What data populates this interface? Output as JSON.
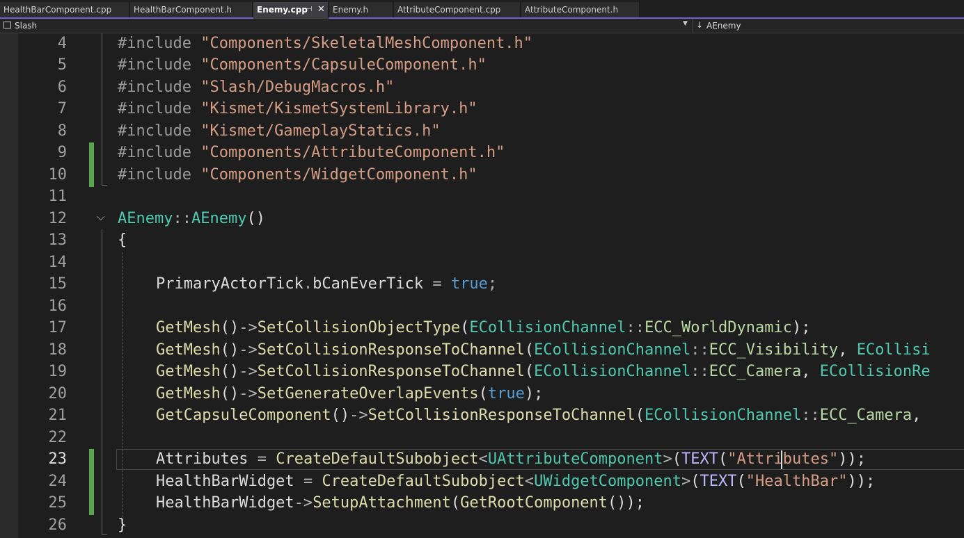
{
  "tabs": [
    {
      "label": "HealthBarComponent.cpp",
      "active": false
    },
    {
      "label": "HealthBarComponent.h",
      "active": false
    },
    {
      "label": "Enemy.cpp",
      "active": true
    },
    {
      "label": "Enemy.h",
      "active": false
    },
    {
      "label": "AttributeComponent.cpp",
      "active": false
    },
    {
      "label": "AttributeComponent.h",
      "active": false
    }
  ],
  "navbar": {
    "project": "Slash",
    "scope": "AEnemy"
  },
  "icons": {
    "pin": "pin-icon",
    "close": "close-icon",
    "project": "project-icon",
    "dropdown": "chevron-down-icon",
    "scope": "member-icon",
    "fold": "fold-chevron-icon"
  },
  "colors": {
    "keyword": "#569cd6",
    "string": "#d69d85",
    "type": "#4ec9b0",
    "function": "#dcdcaa",
    "macro": "#beb7ff",
    "enum": "#b8d7a3",
    "change_marker": "#57a64a",
    "tab_accent": "#6f5fd0"
  },
  "editor": {
    "current_line": 23,
    "lines": [
      {
        "n": "4",
        "text": "#include \"Components/SkeletalMeshComponent.h\""
      },
      {
        "n": "5",
        "text": "#include \"Components/CapsuleComponent.h\""
      },
      {
        "n": "6",
        "text": "#include \"Slash/DebugMacros.h\""
      },
      {
        "n": "7",
        "text": "#include \"Kismet/KismetSystemLibrary.h\""
      },
      {
        "n": "8",
        "text": "#include \"Kismet/GameplayStatics.h\""
      },
      {
        "n": "9",
        "text": "#include \"Components/AttributeComponent.h\"",
        "changed": true
      },
      {
        "n": "10",
        "text": "#include \"Components/WidgetComponent.h\"",
        "changed": true
      },
      {
        "n": "11",
        "text": ""
      },
      {
        "n": "12",
        "text": "AEnemy::AEnemy()"
      },
      {
        "n": "13",
        "text": "{"
      },
      {
        "n": "14",
        "text": ""
      },
      {
        "n": "15",
        "text": "PrimaryActorTick.bCanEverTick = true;"
      },
      {
        "n": "16",
        "text": ""
      },
      {
        "n": "17",
        "text": "GetMesh()->SetCollisionObjectType(ECollisionChannel::ECC_WorldDynamic);"
      },
      {
        "n": "18",
        "text": "GetMesh()->SetCollisionResponseToChannel(ECollisionChannel::ECC_Visibility, ECollisi"
      },
      {
        "n": "19",
        "text": "GetMesh()->SetCollisionResponseToChannel(ECollisionChannel::ECC_Camera, ECollisionRe"
      },
      {
        "n": "20",
        "text": "GetMesh()->SetGenerateOverlapEvents(true);"
      },
      {
        "n": "21",
        "text": "GetCapsuleComponent()->SetCollisionResponseToChannel(ECollisionChannel::ECC_Camera,"
      },
      {
        "n": "22",
        "text": ""
      },
      {
        "n": "23",
        "text": "Attributes = CreateDefaultSubobject<UAttributeComponent>(TEXT(\"Attributes\"));",
        "changed": true
      },
      {
        "n": "24",
        "text": "HealthBarWidget = CreateDefaultSubobject<UWidgetComponent>(TEXT(\"HealthBar\"));",
        "changed": true
      },
      {
        "n": "25",
        "text": "HealthBarWidget->SetupAttachment(GetRootComponent());",
        "changed": true
      },
      {
        "n": "26",
        "text": "}"
      }
    ]
  }
}
